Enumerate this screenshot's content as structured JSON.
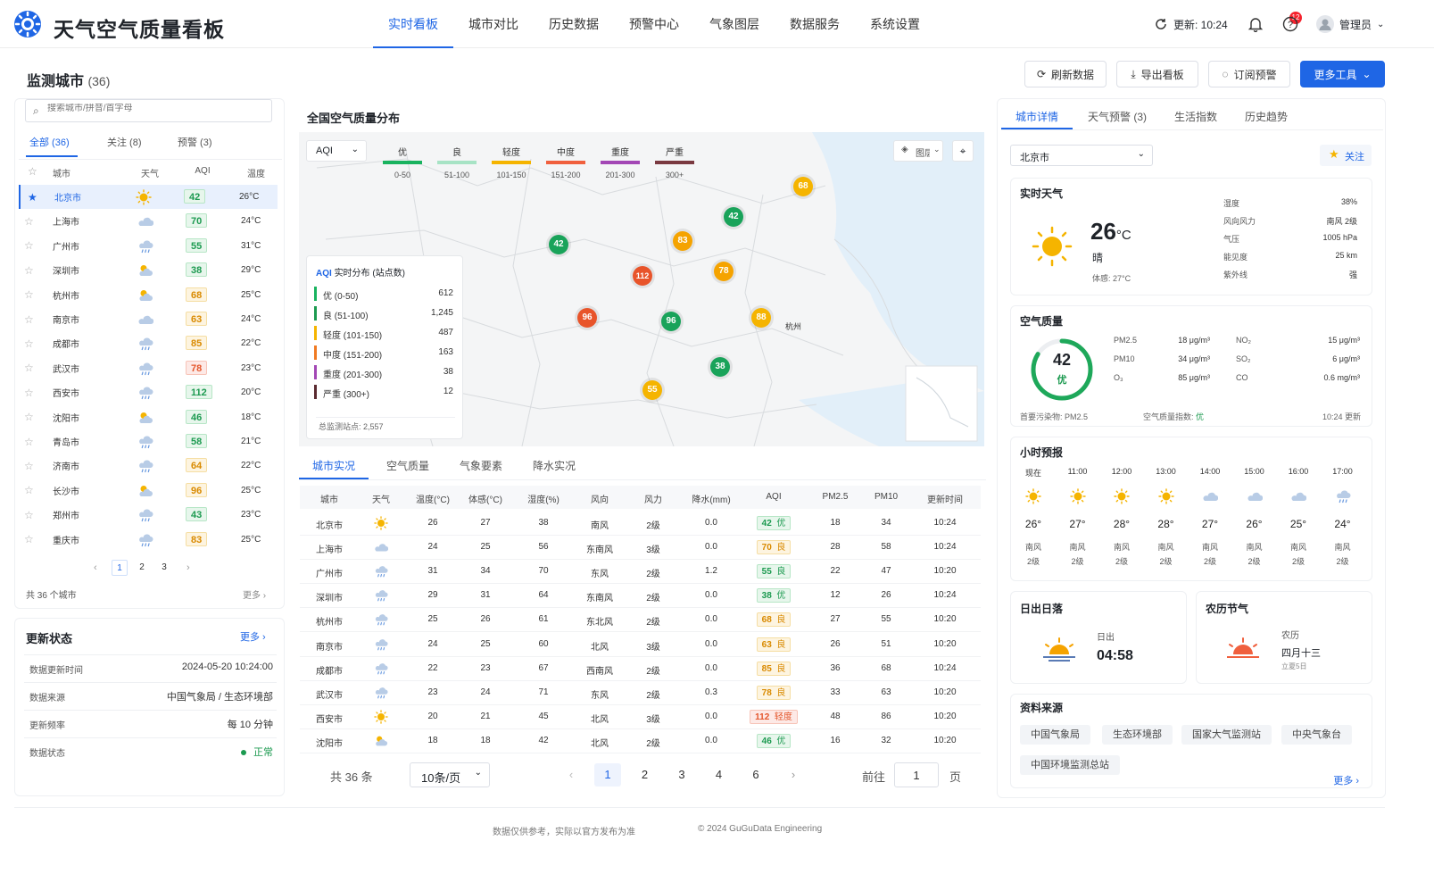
{
  "app": {
    "title": "天气空气质量看板",
    "nav": [
      "实时看板",
      "城市对比",
      "历史数据",
      "预警中心",
      "气象图层",
      "数据服务",
      "系统设置"
    ],
    "update": "更新: 10:24",
    "bell_count": "12",
    "user": "管理员"
  },
  "page": {
    "title": "监测城市",
    "count": "(36)"
  },
  "toolbar": {
    "refresh": "刷新数据",
    "export": "导出看板",
    "subscribe": "订阅预警",
    "more": "更多工具"
  },
  "left": {
    "search_placeholder": "搜索城市/拼音/首字母",
    "tabs": [
      "全部 (36)",
      "关注 (8)",
      "预警 (3)"
    ],
    "headers": [
      "城市",
      "天气",
      "AQI",
      "温度"
    ],
    "cities": [
      {
        "name": "北京市",
        "wx": "sun",
        "aqi": "42",
        "cls": "good",
        "temp": "26°C"
      },
      {
        "name": "上海市",
        "wx": "cloud",
        "aqi": "70",
        "cls": "good",
        "temp": "24°C"
      },
      {
        "name": "广州市",
        "wx": "rain",
        "aqi": "55",
        "cls": "good",
        "temp": "31°C"
      },
      {
        "name": "深圳市",
        "wx": "partly",
        "aqi": "38",
        "cls": "good",
        "temp": "29°C"
      },
      {
        "name": "杭州市",
        "wx": "partly",
        "aqi": "68",
        "cls": "mod",
        "temp": "25°C"
      },
      {
        "name": "南京市",
        "wx": "cloud",
        "aqi": "63",
        "cls": "mod",
        "temp": "24°C"
      },
      {
        "name": "成都市",
        "wx": "rain",
        "aqi": "85",
        "cls": "mod",
        "temp": "22°C"
      },
      {
        "name": "武汉市",
        "wx": "rain",
        "aqi": "78",
        "cls": "bad",
        "temp": "23°C"
      },
      {
        "name": "西安市",
        "wx": "rain",
        "aqi": "112",
        "cls": "good",
        "temp": "20°C"
      },
      {
        "name": "沈阳市",
        "wx": "partly",
        "aqi": "46",
        "cls": "good",
        "temp": "18°C"
      },
      {
        "name": "青岛市",
        "wx": "rain",
        "aqi": "58",
        "cls": "good",
        "temp": "21°C"
      },
      {
        "name": "济南市",
        "wx": "rain",
        "aqi": "64",
        "cls": "mod",
        "temp": "22°C"
      },
      {
        "name": "长沙市",
        "wx": "partly",
        "aqi": "96",
        "cls": "mod",
        "temp": "25°C"
      },
      {
        "name": "郑州市",
        "wx": "rain",
        "aqi": "43",
        "cls": "good",
        "temp": "23°C"
      },
      {
        "name": "重庆市",
        "wx": "rain",
        "aqi": "83",
        "cls": "mod",
        "temp": "25°C"
      }
    ],
    "pages": [
      "1",
      "2",
      "3"
    ],
    "total": "共 36 个城市",
    "more": "更多"
  },
  "status": {
    "title": "更新状态",
    "more": "更多",
    "rows": [
      {
        "k": "数据更新时间",
        "v": "2024-05-20 10:24:00"
      },
      {
        "k": "数据来源",
        "v": "中国气象局 / 生态环境部"
      },
      {
        "k": "更新频率",
        "v": "每 10 分钟"
      },
      {
        "k": "数据状态",
        "v": "正常"
      }
    ]
  },
  "map": {
    "title": "全国空气质量分布",
    "select": "AQI",
    "layers": "图层",
    "legend": [
      {
        "label": "优",
        "range": "0-50",
        "color": "#19b35f"
      },
      {
        "label": "良",
        "range": "51-100",
        "color": "#a7e3c5"
      },
      {
        "label": "轻度",
        "range": "101-150",
        "color": "#f5b400"
      },
      {
        "label": "中度",
        "range": "151-200",
        "color": "#f0603e"
      },
      {
        "label": "重度",
        "range": "201-300",
        "color": "#a347b5"
      },
      {
        "label": "严重",
        "range": "300+",
        "color": "#7a3940"
      }
    ],
    "dist_title": "实时分布 (站点数)",
    "dist_prefix": "AQI",
    "dist": [
      {
        "label": "优 (0-50)",
        "v": "612",
        "color": "#19b35f"
      },
      {
        "label": "良 (51-100)",
        "v": "1,245",
        "color": "#1c9a50"
      },
      {
        "label": "轻度 (101-150)",
        "v": "487",
        "color": "#f5b400"
      },
      {
        "label": "中度 (151-200)",
        "v": "163",
        "color": "#f07a22"
      },
      {
        "label": "重度 (201-300)",
        "v": "38",
        "color": "#a347b5"
      },
      {
        "label": "严重 (300+)",
        "v": "12",
        "color": "#5a2a30"
      }
    ],
    "total_sites": "总监测站点: 2,557",
    "city_label": "杭州",
    "markers": [
      {
        "v": "68",
        "c": "#f5b400"
      },
      {
        "v": "42",
        "c": "#19a35a"
      },
      {
        "v": "42",
        "c": "#19a35a"
      },
      {
        "v": "83",
        "c": "#f5a300"
      },
      {
        "v": "78",
        "c": "#f5a300"
      },
      {
        "v": "112",
        "c": "#e8542a"
      },
      {
        "v": "96",
        "c": "#e8542a"
      },
      {
        "v": "96",
        "c": "#19a35a"
      },
      {
        "v": "88",
        "c": "#f5b400"
      },
      {
        "v": "38",
        "c": "#19a35a"
      },
      {
        "v": "55",
        "c": "#f5b400"
      }
    ]
  },
  "table": {
    "tabs": [
      "城市实况",
      "空气质量",
      "气象要素",
      "降水实况"
    ],
    "headers": [
      "城市",
      "天气",
      "温度(°C)",
      "体感(°C)",
      "湿度(%)",
      "风向",
      "风力",
      "降水(mm)",
      "AQI",
      "PM2.5",
      "PM10",
      "更新时间"
    ],
    "rows": [
      {
        "city": "北京市",
        "wx": "sun",
        "t": "26",
        "f": "27",
        "h": "38",
        "wd": "南风",
        "wp": "2级",
        "p": "0.0",
        "aqi": "42",
        "lv": "优",
        "cls": "good",
        "pm25": "18",
        "pm10": "34",
        "time": "10:24"
      },
      {
        "city": "上海市",
        "wx": "cloud",
        "t": "24",
        "f": "25",
        "h": "56",
        "wd": "东南风",
        "wp": "3级",
        "p": "0.0",
        "aqi": "70",
        "lv": "良",
        "cls": "mod",
        "pm25": "28",
        "pm10": "58",
        "time": "10:24"
      },
      {
        "city": "广州市",
        "wx": "rain",
        "t": "31",
        "f": "34",
        "h": "70",
        "wd": "东风",
        "wp": "2级",
        "p": "1.2",
        "aqi": "55",
        "lv": "良",
        "cls": "good",
        "pm25": "22",
        "pm10": "47",
        "time": "10:20"
      },
      {
        "city": "深圳市",
        "wx": "rain",
        "t": "29",
        "f": "31",
        "h": "64",
        "wd": "东南风",
        "wp": "2级",
        "p": "0.0",
        "aqi": "38",
        "lv": "优",
        "cls": "good",
        "pm25": "12",
        "pm10": "26",
        "time": "10:24"
      },
      {
        "city": "杭州市",
        "wx": "rain",
        "t": "25",
        "f": "26",
        "h": "61",
        "wd": "东北风",
        "wp": "2级",
        "p": "0.0",
        "aqi": "68",
        "lv": "良",
        "cls": "mod",
        "pm25": "27",
        "pm10": "55",
        "time": "10:20"
      },
      {
        "city": "南京市",
        "wx": "rain",
        "t": "24",
        "f": "25",
        "h": "60",
        "wd": "北风",
        "wp": "3级",
        "p": "0.0",
        "aqi": "63",
        "lv": "良",
        "cls": "mod",
        "pm25": "26",
        "pm10": "51",
        "time": "10:20"
      },
      {
        "city": "成都市",
        "wx": "rain",
        "t": "22",
        "f": "23",
        "h": "67",
        "wd": "西南风",
        "wp": "2级",
        "p": "0.0",
        "aqi": "85",
        "lv": "良",
        "cls": "mod",
        "pm25": "36",
        "pm10": "68",
        "time": "10:24"
      },
      {
        "city": "武汉市",
        "wx": "rain",
        "t": "23",
        "f": "24",
        "h": "71",
        "wd": "东风",
        "wp": "2级",
        "p": "0.3",
        "aqi": "78",
        "lv": "良",
        "cls": "mod",
        "pm25": "33",
        "pm10": "63",
        "time": "10:20"
      },
      {
        "city": "西安市",
        "wx": "sun",
        "t": "20",
        "f": "21",
        "h": "45",
        "wd": "北风",
        "wp": "3级",
        "p": "0.0",
        "aqi": "112",
        "lv": "轻度",
        "cls": "bad",
        "pm25": "48",
        "pm10": "86",
        "time": "10:20"
      },
      {
        "city": "沈阳市",
        "wx": "partly",
        "t": "18",
        "f": "18",
        "h": "42",
        "wd": "北风",
        "wp": "2级",
        "p": "0.0",
        "aqi": "46",
        "lv": "优",
        "cls": "good",
        "pm25": "16",
        "pm10": "32",
        "time": "10:20"
      }
    ],
    "total": "共 36 条",
    "page_size": "10条/页",
    "pages": [
      "1",
      "2",
      "3",
      "4",
      "6"
    ],
    "goto": "前往",
    "goto_val": "1",
    "page_unit": "页"
  },
  "right": {
    "tabs": [
      "城市详情",
      "天气预警 (3)",
      "生活指数",
      "历史趋势"
    ],
    "city": "北京市",
    "follow": "关注",
    "now": {
      "title": "实时天气",
      "temp": "26",
      "unit": "°C",
      "desc": "晴",
      "feel": "体感: 27°C",
      "stats": [
        {
          "k": "湿度",
          "v": "38%"
        },
        {
          "k": "风向风力",
          "v": "南风 2级"
        },
        {
          "k": "气压",
          "v": "1005 hPa"
        },
        {
          "k": "能见度",
          "v": "25 km"
        },
        {
          "k": "紫外线",
          "v": "强"
        }
      ]
    },
    "air": {
      "title": "空气质量",
      "aqi": "42",
      "level": "优",
      "aqi_fraction": 0.84,
      "items": [
        {
          "k": "PM2.5",
          "v": "18 μg/m³"
        },
        {
          "k": "PM10",
          "v": "34 μg/m³"
        },
        {
          "k": "O₃",
          "v": "85 μg/m³"
        },
        {
          "k": "NO₂",
          "v": "15 μg/m³"
        },
        {
          "k": "SO₂",
          "v": "6 μg/m³"
        },
        {
          "k": "CO",
          "v": "0.6 mg/m³"
        }
      ],
      "primary": "首要污染物: PM2.5",
      "index": "空气质量指数:",
      "index_v": "优",
      "time": "10:24 更新"
    },
    "hourly": {
      "title": "小时预报",
      "hours": [
        {
          "h": "现在",
          "wx": "sun",
          "t": "26°",
          "wd": "南风",
          "wp": "2级"
        },
        {
          "h": "11:00",
          "wx": "sun",
          "t": "27°",
          "wd": "南风",
          "wp": "2级"
        },
        {
          "h": "12:00",
          "wx": "sun",
          "t": "28°",
          "wd": "南风",
          "wp": "2级"
        },
        {
          "h": "13:00",
          "wx": "sun",
          "t": "28°",
          "wd": "南风",
          "wp": "2级"
        },
        {
          "h": "14:00",
          "wx": "cloud",
          "t": "27°",
          "wd": "南风",
          "wp": "2级"
        },
        {
          "h": "15:00",
          "wx": "cloud",
          "t": "26°",
          "wd": "南风",
          "wp": "2级"
        },
        {
          "h": "16:00",
          "wx": "cloud",
          "t": "25°",
          "wd": "南风",
          "wp": "2级"
        },
        {
          "h": "17:00",
          "wx": "rain",
          "t": "24°",
          "wd": "南风",
          "wp": "2级"
        }
      ]
    },
    "sun": {
      "title": "日出日落",
      "label": "日出",
      "time": "04:58"
    },
    "lunar": {
      "title": "农历节气",
      "label": "农历",
      "date": "四月十三",
      "term": "立夏5日"
    },
    "sources": {
      "title": "资料来源",
      "items": [
        "中国气象局",
        "生态环境部",
        "国家大气监测站",
        "中央气象台",
        "中国环境监测总站"
      ],
      "more": "更多"
    }
  },
  "footer": {
    "note": "数据仅供参考，实际以官方发布为准",
    "copy": "© 2024 GuGuData Engineering"
  }
}
